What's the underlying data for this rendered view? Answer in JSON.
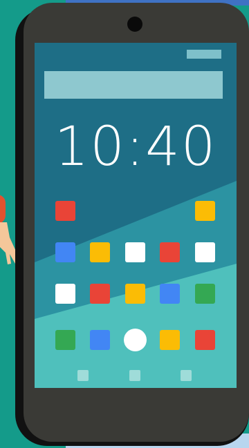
{
  "clock": {
    "time": "10:40"
  },
  "colors": {
    "background": "#149b8a",
    "phone_body": "#3a3a36",
    "screen_dark": "#1e6e86",
    "screen_mid": "#2c93a2",
    "screen_light": "#4fc0bc",
    "red": "#e94437",
    "yellow": "#fbbc05",
    "blue": "#4286f4",
    "green": "#34a853",
    "white": "#ffffff"
  },
  "apps": [
    {
      "name": "app-icon",
      "color": "red"
    },
    {
      "name": "app-icon",
      "color": "yellow"
    },
    {
      "name": "app-icon",
      "color": "blue"
    },
    {
      "name": "app-icon",
      "color": "yellow"
    },
    {
      "name": "app-icon",
      "color": "white"
    },
    {
      "name": "app-icon",
      "color": "red"
    },
    {
      "name": "app-icon",
      "color": "white"
    },
    {
      "name": "app-icon",
      "color": "white"
    },
    {
      "name": "app-icon",
      "color": "red"
    },
    {
      "name": "app-icon",
      "color": "yellow"
    },
    {
      "name": "app-icon",
      "color": "blue"
    },
    {
      "name": "app-icon",
      "color": "green"
    },
    {
      "name": "app-icon",
      "color": "green"
    },
    {
      "name": "app-icon",
      "color": "blue"
    },
    {
      "name": "home-button",
      "color": "white"
    },
    {
      "name": "app-icon",
      "color": "yellow"
    },
    {
      "name": "app-icon",
      "color": "red"
    }
  ]
}
